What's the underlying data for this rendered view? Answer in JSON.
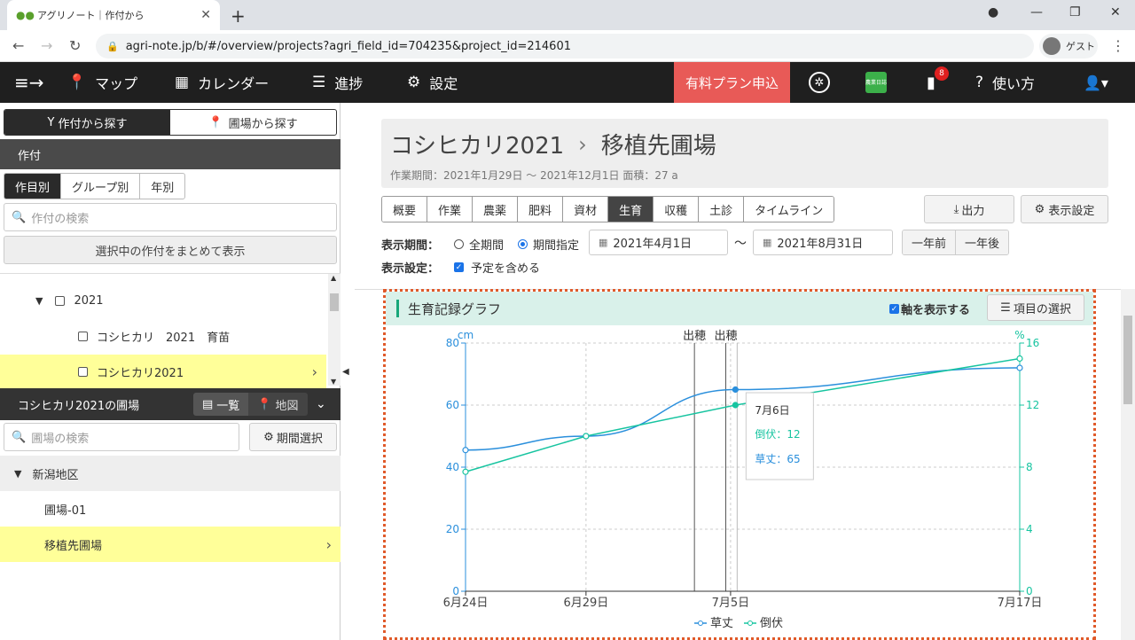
{
  "browser": {
    "tab_title": "アグリノート｜作付から",
    "url": "agri-note.jp/b/#/overview/projects?agri_field_id=704235&project_id=214601",
    "profile": "ゲスト"
  },
  "header": {
    "nav": [
      "マップ",
      "カレンダー",
      "進捗",
      "設定"
    ],
    "plan_button": "有料プラン申込",
    "notifications": "8",
    "help": "使い方",
    "ledger_icon_text": "農業日誌"
  },
  "sidebar": {
    "search_mode": [
      "作付から探す",
      "圃場から探す"
    ],
    "section_title": "作付",
    "subtabs": [
      "作目別",
      "グループ別",
      "年別"
    ],
    "crop_search_placeholder": "作付の検索",
    "show_selected": "選択中の作付をまとめて表示",
    "tree": {
      "year": "2021",
      "items": [
        "コシヒカリ　2021　育苗",
        "コシヒカリ2021"
      ]
    },
    "field_section_title": "コシヒカリ2021の圃場",
    "view_toggle": [
      "一覧",
      "地図"
    ],
    "field_search_placeholder": "圃場の検索",
    "period_button": "期間選択",
    "region": "新潟地区",
    "fields": [
      "圃場-01",
      "移植先圃場"
    ]
  },
  "main": {
    "breadcrumb": [
      "コシヒカリ2021",
      "移植先圃場"
    ],
    "subtitle": "作業期間：2021年1月29日 〜 2021年12月1日 面積：27 a",
    "tabs": [
      "概要",
      "作業",
      "農薬",
      "肥料",
      "資材",
      "生育",
      "収穫",
      "土診",
      "タイムライン"
    ],
    "active_tab": "生育",
    "export": "出力",
    "display_settings": "表示設定",
    "period_label": "表示期間：",
    "period_options": [
      "全期間",
      "期間指定"
    ],
    "date_from": "2021年4月1日",
    "date_sep": "〜",
    "date_to": "2021年8月31日",
    "prev_year": "一年前",
    "next_year": "一年後",
    "settings_label": "表示設定：",
    "include_planned": "予定を含める"
  },
  "chart_panel": {
    "title": "生育記録グラフ",
    "show_axis": "軸を表示する",
    "select_items": "項目の選択",
    "tooltip": {
      "date": "7月6日",
      "line1": "倒伏：12",
      "line2": "草丈：65"
    }
  },
  "colors": {
    "series_height": "#2a8fdc",
    "series_lodging": "#17c4a0",
    "plan_button": "#e85a57",
    "header_bg": "#1f1f1f",
    "highlight": "#ffff99"
  },
  "chart_data": {
    "type": "line",
    "x": [
      "6月24日",
      "6月29日",
      "7月5日",
      "7月17日"
    ],
    "x_days": [
      0,
      5,
      11,
      23
    ],
    "y_left_unit": "cm",
    "y_right_unit": "%",
    "y_left_ticks": [
      0,
      20,
      40,
      60,
      80
    ],
    "y_right_ticks": [
      0,
      4,
      8,
      12,
      16
    ],
    "ylim_left": [
      0,
      80
    ],
    "ylim_right": [
      0,
      16
    ],
    "events": [
      {
        "label": "出穂",
        "day": 9.5
      },
      {
        "label": "出穂",
        "day": 10.8
      }
    ],
    "series": [
      {
        "name": "草丈",
        "axis": "left",
        "x_days": [
          0,
          5,
          11.2,
          23
        ],
        "values": [
          45.5,
          50,
          65,
          72
        ]
      },
      {
        "name": "倒伏",
        "axis": "right",
        "x_days": [
          0,
          5,
          11.2,
          23
        ],
        "values": [
          7.7,
          10,
          12,
          15
        ]
      }
    ],
    "legend": "bottom",
    "grid": true
  }
}
